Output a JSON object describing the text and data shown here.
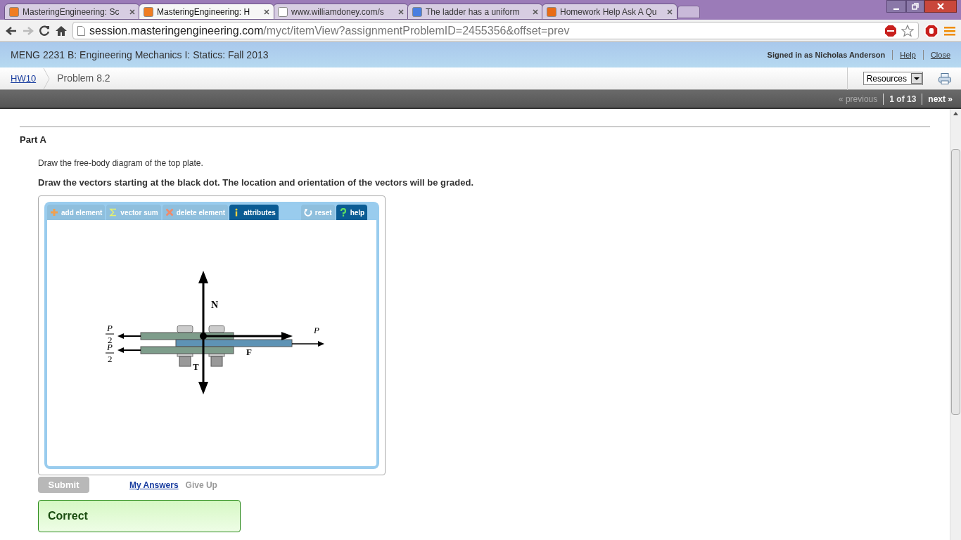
{
  "browser": {
    "tabs": [
      {
        "title": "MasteringEngineering: Sc",
        "kind": "mastering",
        "selected": false
      },
      {
        "title": "MasteringEngineering: H",
        "kind": "mastering",
        "selected": true
      },
      {
        "title": "www.williamdoney.com/s",
        "kind": "page",
        "selected": false
      },
      {
        "title": "The ladder has a uniform",
        "kind": "google",
        "selected": false
      },
      {
        "title": "Homework Help Ask A Qu",
        "kind": "chegg",
        "selected": false
      }
    ],
    "url_host": "session.masteringengineering.com",
    "url_path": "/myct/itemView?assignmentProblemID=2455356&offset=prev"
  },
  "header": {
    "course": "MENG 2231 B: Engineering Mechanics I: Statics: Fall 2013",
    "signed_in": "Signed in as Nicholas Anderson",
    "links": [
      "Help",
      "Close"
    ]
  },
  "breadcrumb": {
    "assignment": "HW10",
    "problem": "Problem 8.2",
    "resources": "Resources"
  },
  "pager": {
    "previous": "« previous",
    "position": "1 of 13",
    "next": "next »"
  },
  "part": {
    "title": "Part A",
    "instruction": "Draw the free-body diagram of the top plate.",
    "note": "Draw the vectors starting at the black dot. The location and orientation of the vectors will be graded."
  },
  "tool": {
    "buttons": [
      {
        "label": "add element",
        "kind": "add",
        "disabled": true
      },
      {
        "label": "vector sum",
        "kind": "sum",
        "disabled": true
      },
      {
        "label": "delete element",
        "kind": "delete",
        "disabled": true
      },
      {
        "label": "attributes",
        "kind": "info",
        "disabled": false
      },
      {
        "label": "reset",
        "kind": "reset",
        "disabled": true
      },
      {
        "label": "help",
        "kind": "help",
        "disabled": false
      }
    ],
    "labels": {
      "n": "N",
      "p_half_num": "P",
      "p": "P",
      "p_half_den": "2",
      "p_half2_num": "P",
      "f": "F",
      "p_half2_den": "2",
      "t": "T"
    }
  },
  "actions": {
    "submit": "Submit",
    "submit_disabled": true,
    "my_answers": "My Answers",
    "give_up": "Give Up",
    "give_up_disabled": true
  },
  "feedback": {
    "text": "Correct",
    "correct": true
  }
}
